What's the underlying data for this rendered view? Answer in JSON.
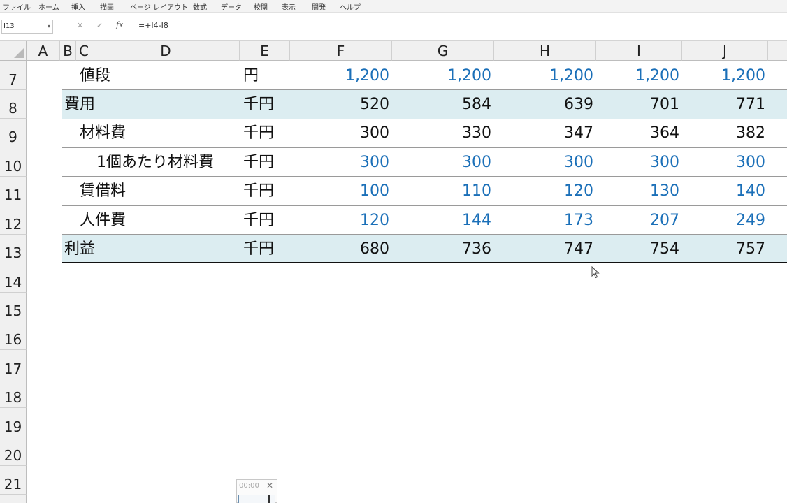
{
  "ribbon": {
    "tabs": [
      "ファイル",
      "ホーム",
      "挿入",
      "描画",
      "ページ レイアウト",
      "数式",
      "データ",
      "校閲",
      "表示",
      "開発",
      "ヘルプ"
    ]
  },
  "formula_bar": {
    "name_box": "I13",
    "fx": "fx",
    "formula": "=+I4-I8"
  },
  "columns": [
    "A",
    "B",
    "C",
    "D",
    "E",
    "F",
    "G",
    "H",
    "I",
    "J"
  ],
  "rows": [
    {
      "num": "7",
      "label": "値段",
      "unit": "円",
      "values": [
        "1,200",
        "1,200",
        "1,200",
        "1,200",
        "1,200"
      ]
    },
    {
      "num": "8",
      "label": "費用",
      "unit": "千円",
      "values": [
        "520",
        "584",
        "639",
        "701",
        "771"
      ]
    },
    {
      "num": "9",
      "label": "材料費",
      "unit": "千円",
      "values": [
        "300",
        "330",
        "347",
        "364",
        "382"
      ]
    },
    {
      "num": "10",
      "label": "1個あたり材料費",
      "unit": "千円",
      "values": [
        "300",
        "300",
        "300",
        "300",
        "300"
      ]
    },
    {
      "num": "11",
      "label": "賃借料",
      "unit": "千円",
      "values": [
        "100",
        "110",
        "120",
        "130",
        "140"
      ]
    },
    {
      "num": "12",
      "label": "人件費",
      "unit": "千円",
      "values": [
        "120",
        "144",
        "173",
        "207",
        "249"
      ]
    },
    {
      "num": "13",
      "label": "利益",
      "unit": "千円",
      "values": [
        "680",
        "736",
        "747",
        "754",
        "757"
      ]
    }
  ],
  "empty_rows": [
    "14",
    "15",
    "16",
    "17",
    "18",
    "19",
    "20",
    "21"
  ],
  "timer": {
    "time": "00:00",
    "close": "✕"
  },
  "colors": {
    "input_blue": "#1a6fb8",
    "band": "#dcedf1"
  }
}
